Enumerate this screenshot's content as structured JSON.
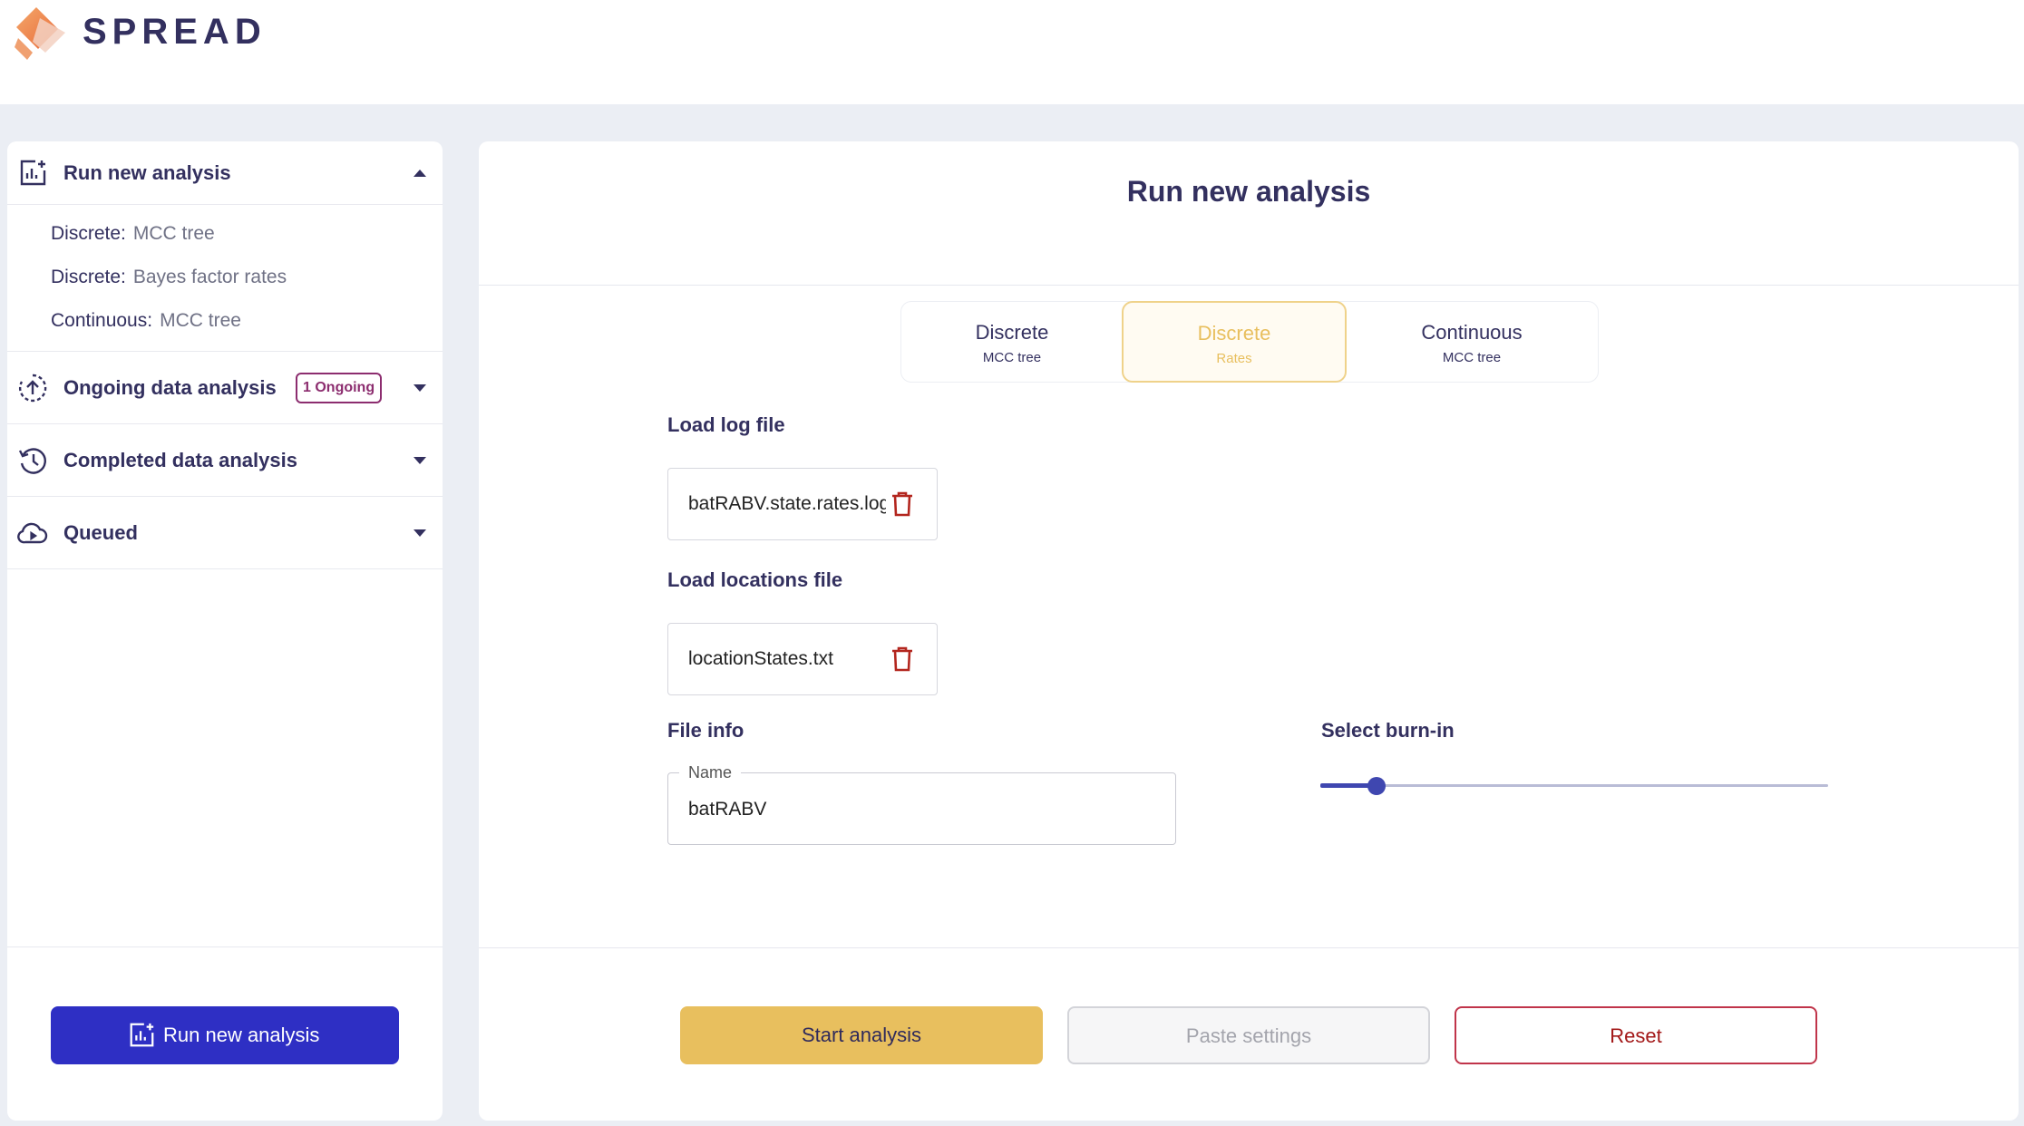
{
  "app": {
    "brand": "SPREAD"
  },
  "sidebar": {
    "sections": [
      {
        "title": "Run new analysis",
        "icon": "analytics-plus-icon",
        "expanded": true
      },
      {
        "title": "Ongoing data analysis",
        "icon": "upload-progress-icon",
        "badge": "1 Ongoing"
      },
      {
        "title": "Completed data analysis",
        "icon": "history-icon"
      },
      {
        "title": "Queued",
        "icon": "cloud-play-icon"
      }
    ],
    "run_items": [
      {
        "kind": "Discrete:",
        "value": "MCC tree"
      },
      {
        "kind": "Discrete:",
        "value": "Bayes factor rates"
      },
      {
        "kind": "Continuous:",
        "value": "MCC tree"
      }
    ],
    "button_label": "Run new analysis"
  },
  "main": {
    "title": "Run new analysis",
    "tabs": [
      {
        "label": "Discrete",
        "sub": "MCC tree"
      },
      {
        "label": "Discrete",
        "sub": "Rates",
        "active": true
      },
      {
        "label": "Continuous",
        "sub": "MCC tree"
      }
    ],
    "log_label": "Load log file",
    "log_file": "batRABV.state.rates.log",
    "locations_label": "Load locations file",
    "locations_file": "locationStates.txt",
    "file_info_label": "File info",
    "name_label": "Name",
    "name_value": "batRABV",
    "burnin_label": "Select burn-in",
    "burnin_value": 0.11,
    "buttons": {
      "start": "Start analysis",
      "paste": "Paste settings",
      "reset": "Reset"
    }
  },
  "colors": {
    "primary": "#2e2fc4",
    "accent": "#e8bf5e",
    "danger": "#c0344a",
    "text": "#33305f"
  }
}
